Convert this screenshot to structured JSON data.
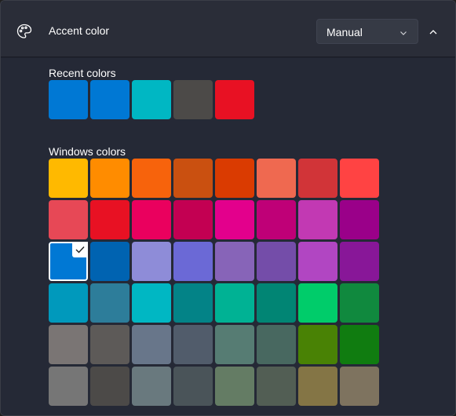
{
  "header": {
    "title": "Accent color",
    "mode_value": "Manual"
  },
  "recent": {
    "label": "Recent colors",
    "colors": [
      "#0078d4",
      "#0078d4",
      "#00b7c3",
      "#4c4a48",
      "#e81123"
    ]
  },
  "windows": {
    "label": "Windows colors",
    "selected_index": 16,
    "colors": [
      "#ffb900",
      "#ff8c00",
      "#f7630c",
      "#ca5010",
      "#da3b01",
      "#ef6950",
      "#d13438",
      "#ff4343",
      "#e74856",
      "#e81123",
      "#ea005e",
      "#c30052",
      "#e3008c",
      "#bf0077",
      "#c239b3",
      "#9a0089",
      "#0078d4",
      "#0063b1",
      "#8e8cd8",
      "#6b69d6",
      "#8764b8",
      "#744da9",
      "#b146c2",
      "#881798",
      "#0099bc",
      "#2d7d9a",
      "#00b7c3",
      "#038387",
      "#00b294",
      "#018574",
      "#00cc6a",
      "#10893e",
      "#7a7574",
      "#5d5a58",
      "#68768a",
      "#515c6b",
      "#567c73",
      "#486860",
      "#498205",
      "#107c10",
      "#767676",
      "#4c4a48",
      "#69797e",
      "#4a5459",
      "#647c64",
      "#525e54",
      "#847545",
      "#7e735f"
    ]
  }
}
